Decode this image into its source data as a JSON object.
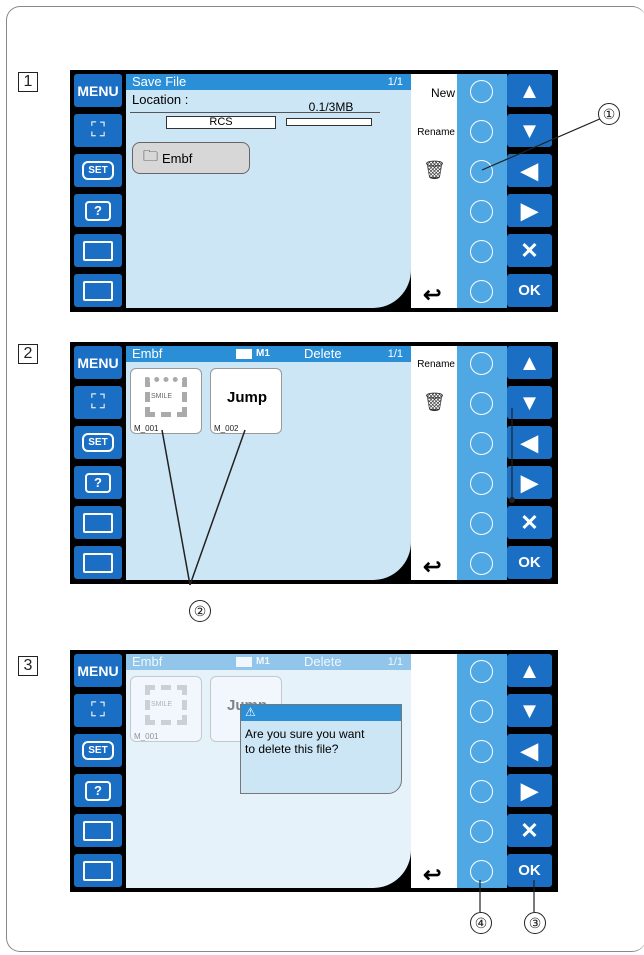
{
  "steps": [
    "1",
    "2",
    "3"
  ],
  "left_buttons": {
    "menu": "MENU",
    "set": "SET",
    "help": "?"
  },
  "nav": {
    "up": "▲",
    "down": "▼",
    "left": "◀",
    "right": "▶",
    "cancel": "✕",
    "ok": "OK"
  },
  "panel1": {
    "title": "Save File",
    "page": "1/1",
    "location_label": "Location :",
    "location_value": "RCS",
    "capacity": "0.1/3MB",
    "folder": "Embf",
    "soft_new": "New",
    "soft_rename": "Rename"
  },
  "panel2": {
    "title": "Embf",
    "mode": "M1",
    "action": "Delete",
    "page": "1/1",
    "soft_rename": "Rename",
    "tile1_name": "M_001",
    "tile1_text": "SMILE",
    "tile2_name": "M_002",
    "tile2_text": "Jump"
  },
  "panel3": {
    "title": "Embf",
    "mode": "M1",
    "action": "Delete",
    "page": "1/1",
    "tile1_name": "M_001",
    "tile1_text": "SMILE",
    "tile2_text": "Jump",
    "dialog_icon": "⚠",
    "dialog_message_line1": "Are you sure you want",
    "dialog_message_line2": "to delete this file?"
  },
  "callouts": [
    "①",
    "②",
    "③",
    "④"
  ],
  "colors": {
    "button_blue": "#1a6fc4",
    "panel_bg": "#cde6f5",
    "title_blue": "#2b8fd8",
    "circle_col": "#4fa8e4"
  }
}
